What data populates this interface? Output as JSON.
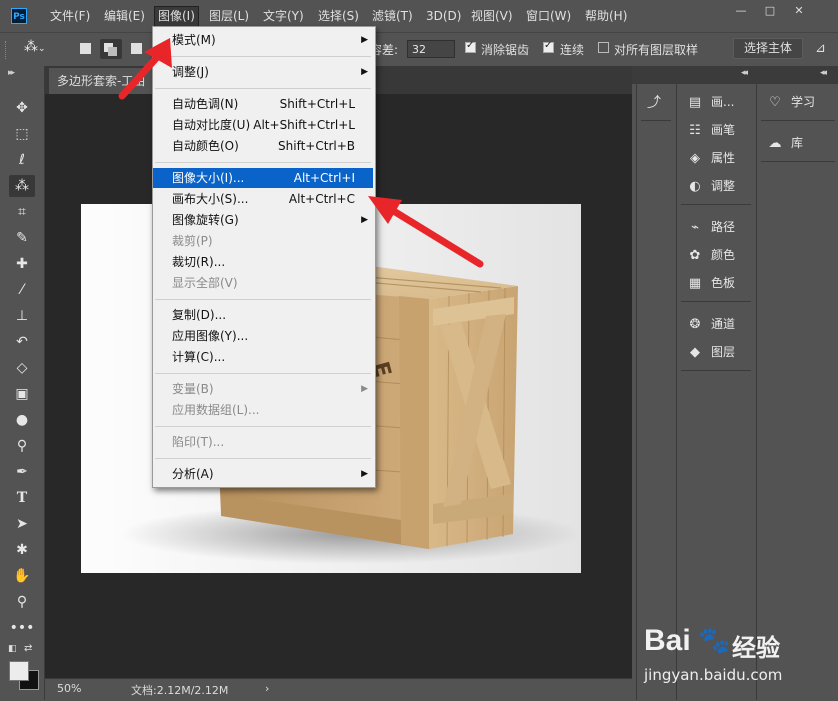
{
  "app": {
    "logo_text": "Ps"
  },
  "menubar": {
    "items": [
      "文件(F)",
      "编辑(E)",
      "图像(I)",
      "图层(L)",
      "文字(Y)",
      "选择(S)",
      "滤镜(T)",
      "3D(D)",
      "视图(V)",
      "窗口(W)",
      "帮助(H)"
    ],
    "active": "图像(I)"
  },
  "window_controls": {
    "minimize": "—",
    "maximize": "□",
    "close": "✕"
  },
  "options_bar": {
    "tolerance_label": "容差:",
    "tolerance_value": "32",
    "antialias_label": "消除锯齿",
    "antialias_checked": true,
    "contiguous_label": "连续",
    "contiguous_checked": true,
    "sample_all_label": "对所有图层取样",
    "sample_all_checked": false,
    "select_subject_label": "选择主体"
  },
  "document": {
    "tab_title": "多边形套索-工由",
    "zoom": "50%",
    "doc_info": "文档:2.12M/2.12M",
    "status_arrow": "›"
  },
  "image_menu": {
    "items": [
      {
        "label": "模式(M)",
        "shortcut": "",
        "submenu": true,
        "disabled": false
      },
      {
        "sep": true
      },
      {
        "label": "调整(J)",
        "shortcut": "",
        "submenu": true,
        "disabled": false
      },
      {
        "sep": true
      },
      {
        "label": "自动色调(N)",
        "shortcut": "Shift+Ctrl+L",
        "submenu": false,
        "disabled": false
      },
      {
        "label": "自动对比度(U)",
        "shortcut": "Alt+Shift+Ctrl+L",
        "submenu": false,
        "disabled": false
      },
      {
        "label": "自动颜色(O)",
        "shortcut": "Shift+Ctrl+B",
        "submenu": false,
        "disabled": false
      },
      {
        "sep": true
      },
      {
        "label": "图像大小(I)...",
        "shortcut": "Alt+Ctrl+I",
        "submenu": false,
        "disabled": false,
        "highlighted": true
      },
      {
        "label": "画布大小(S)...",
        "shortcut": "Alt+Ctrl+C",
        "submenu": false,
        "disabled": false
      },
      {
        "label": "图像旋转(G)",
        "shortcut": "",
        "submenu": true,
        "disabled": false
      },
      {
        "label": "裁剪(P)",
        "shortcut": "",
        "submenu": false,
        "disabled": true
      },
      {
        "label": "裁切(R)...",
        "shortcut": "",
        "submenu": false,
        "disabled": false
      },
      {
        "label": "显示全部(V)",
        "shortcut": "",
        "submenu": false,
        "disabled": true
      },
      {
        "sep": true
      },
      {
        "label": "复制(D)...",
        "shortcut": "",
        "submenu": false,
        "disabled": false
      },
      {
        "label": "应用图像(Y)...",
        "shortcut": "",
        "submenu": false,
        "disabled": false
      },
      {
        "label": "计算(C)...",
        "shortcut": "",
        "submenu": false,
        "disabled": false
      },
      {
        "sep": true
      },
      {
        "label": "变量(B)",
        "shortcut": "",
        "submenu": true,
        "disabled": true
      },
      {
        "label": "应用数据组(L)...",
        "shortcut": "",
        "submenu": false,
        "disabled": true
      },
      {
        "sep": true
      },
      {
        "label": "陷印(T)...",
        "shortcut": "",
        "submenu": false,
        "disabled": true
      },
      {
        "sep": true
      },
      {
        "label": "分析(A)",
        "shortcut": "",
        "submenu": true,
        "disabled": false
      }
    ]
  },
  "panels": {
    "col_a": [
      {
        "label": "画...",
        "icon": "brush-settings-icon"
      },
      {
        "label": "画笔",
        "icon": "brushes-icon"
      },
      {
        "label": "属性",
        "icon": "properties-icon"
      },
      {
        "label": "调整",
        "icon": "adjustments-icon"
      },
      {
        "label": "路径",
        "icon": "paths-icon"
      },
      {
        "label": "颜色",
        "icon": "color-icon"
      },
      {
        "label": "色板",
        "icon": "swatches-icon"
      },
      {
        "label": "通道",
        "icon": "channels-icon"
      },
      {
        "label": "图层",
        "icon": "layers-icon"
      }
    ],
    "col_b": [
      {
        "label": "学习",
        "icon": "learn-icon"
      },
      {
        "label": "库",
        "icon": "libraries-icon"
      }
    ]
  },
  "watermark": {
    "brand": "Bai",
    "brand_suffix": "经验",
    "url": "jingyan.baidu.com"
  },
  "colors": {
    "ui_bg": "#535353",
    "doc_bg": "#282828",
    "menu_highlight": "#0a63c9",
    "annotation_red": "#e8262a"
  }
}
